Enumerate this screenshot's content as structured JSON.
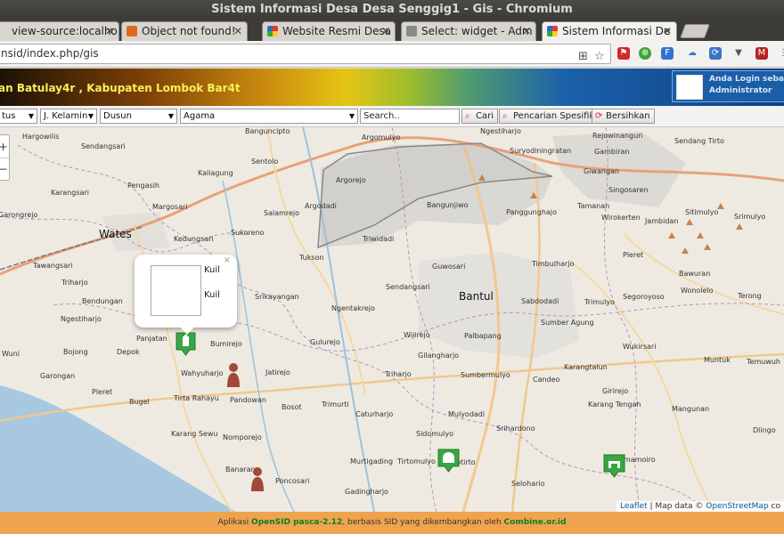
{
  "window": {
    "title": "Sistem Informasi Desa Desa Senggig1 - Gis - Chromium"
  },
  "tabs": [
    {
      "label": "view-source:localho"
    },
    {
      "label": "Object not found!"
    },
    {
      "label": "Website Resmi Desa"
    },
    {
      "label": "Select: widget - Adm"
    },
    {
      "label": "Sistem Informasi De"
    }
  ],
  "address_bar": {
    "url": "nsid/index.php/gis"
  },
  "header": {
    "title": "an Batulay4r , Kabupaten Lombok Bar4t",
    "login_line1": "Anda Login sebagai",
    "login_line2": "Administrator"
  },
  "filters": {
    "status": "tus",
    "gender": "J. Kelamin",
    "dusun": "Dusun",
    "agama": "Agama",
    "search_placeholder": "Search..",
    "cari_label": "Cari",
    "pencarian_label": "Pencarian Spesifik",
    "bersihkan_label": "Bersihkan"
  },
  "map": {
    "zoom_in": "+",
    "zoom_out": "−",
    "places": {
      "hargowilis": "Hargowilis",
      "sendangsari_n": "Sendangsari",
      "kaliagung": "Kaliagung",
      "sentolo": "Sentolo",
      "banguncipto": "Banguncipto",
      "argomulyo": "Argomulyo",
      "ngestiharjo_n": "Ngestiharjo",
      "suryodiningratan": "Suryodiningratan",
      "rejowinangun": "Rejowinangun",
      "sendang_tirto": "Sendang Tirto",
      "gambiran": "Gambiran",
      "giwangan": "Giwangan",
      "karangsari": "Karangsari",
      "pengasih": "Pengasih",
      "argorejo": "Argorejo",
      "singosaren": "Singosaren",
      "margosari": "Margosari",
      "salamrejo": "Salamrejo",
      "argodadi": "Argodadi",
      "bangunjiwo": "Bangunjiwo",
      "tamanan": "Tamanan",
      "wirokerten": "Wirokerten",
      "jambidan": "Jambidan",
      "sitimulyo": "Sitimulyo",
      "srimulyo": "Srimulyo",
      "garongrejo": "Garongrejo",
      "wates": "Wates",
      "kedungsari": "Kedungsari",
      "sukoreno": "Sukoreno",
      "triwidadi": "Triwidadi",
      "panggunghajo": "Panggunghajo",
      "tukson": "Tukson",
      "tawangsari": "Tawangsari",
      "pleret_e": "Pleret",
      "guwosari": "Guwosari",
      "timbulharjo": "Timbulharjo",
      "triharjo_w": "Triharjo",
      "sendangsari_c": "Sendangsari",
      "bawuran": "Bawuran",
      "segoroyoso": "Segoroyoso",
      "wonolelo": "Wonolelo",
      "terong": "Terong",
      "bantul": "Bantul",
      "srikayangan": "Srikayangan",
      "bendungan": "Bendungan",
      "sabdodadi": "Sabdodadi",
      "trimulyo_e": "Trimulyo",
      "ngentakrejo": "Ngentakrejo",
      "ngestiharjo_w": "Ngestiharjo",
      "sumber_agung": "Sumber Agung",
      "panjatan": "Panjatan",
      "bumirejo": "Bumirejo",
      "gulurejo": "Gulurejo",
      "wijirejo": "Wijirejo",
      "palbapang": "Palbapang",
      "wukirsari": "Wukirsari",
      "temuwuh": "Temuwuh",
      "bojong": "Bojong",
      "depok": "Depok",
      "gilangharjo": "Gilangharjo",
      "muntuk": "Muntuk",
      "karangtalun": "Karangtalun",
      "wuni": "Wuni",
      "wahyuharjo": "Wahyuharjo",
      "jatirejo": "Jatirejo",
      "triharjo_c": "Triharjo",
      "sumbermulyo": "Sumbermulyo",
      "candeo": "Candeo",
      "garongan": "Garongan",
      "girirejo": "Girirejo",
      "pleret_w": "Pleret",
      "bugel": "Bugel",
      "tirta_rahayu": "Tirta Rahayu",
      "pandowan": "Pandowan",
      "bosot": "Bosot",
      "trimurti": "Trimurti",
      "karang_tengah": "Karang Tengah",
      "mangunan": "Mangunan",
      "caturharjo": "Caturharjo",
      "mulyodadi": "Mulyodadi",
      "karang_sewu": "Karang Sewu",
      "nomporejo": "Nomporejo",
      "srihardono": "Srihardono",
      "dlingo": "Dlingo",
      "sidomulyo": "Sidomulyo",
      "banaran": "Banaran",
      "murtigading": "Murtigading",
      "tirtomulyo": "Tirtomulyo",
      "poncosari": "Poncosari",
      "mamoiro": "mamoiro",
      "donotirto": "Donotirto",
      "selohario": "Selohario",
      "gadingharjo": "Gadingharjo"
    },
    "popup": {
      "line1": "Kuil",
      "line2": "Kuil",
      "close": "×"
    },
    "attribution": {
      "leaflet": "Leaflet",
      "sep": " | Map data © ",
      "osm": "OpenStreetMap",
      "tail": " co"
    }
  },
  "footer": {
    "prefix": "Aplikasi ",
    "app_name": "OpenSID pasca-2.12",
    "middle": ", berbasis SID yang dikembangkan oleh ",
    "vendor": "Combine.or.id"
  }
}
